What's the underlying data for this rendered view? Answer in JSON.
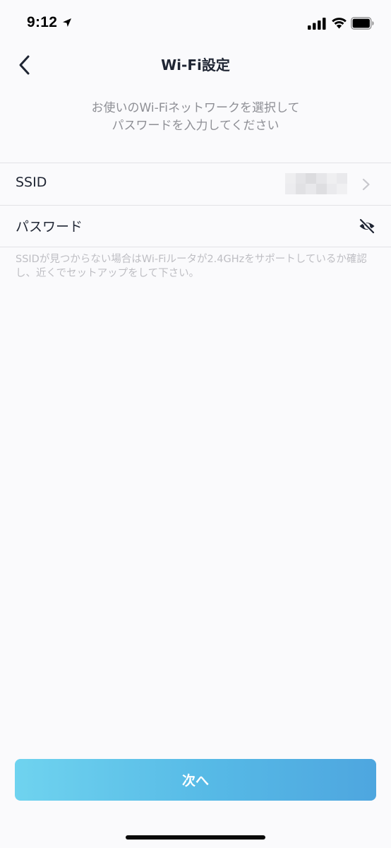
{
  "status_bar": {
    "time": "9:12",
    "icons": [
      "location-arrow-icon",
      "cellular-signal-icon",
      "wifi-icon",
      "battery-icon"
    ]
  },
  "nav": {
    "title": "Wi-Fi設定",
    "back_icon": "chevron-left-icon"
  },
  "instruction": {
    "line1": "お使いのWi-Fiネットワークを選択して",
    "line2": "パスワードを入力してください"
  },
  "form": {
    "ssid": {
      "label": "SSID",
      "value_blurred": true,
      "trailing_icon": "chevron-right-icon"
    },
    "password": {
      "label": "パスワード",
      "value": "",
      "trailing_icon": "eye-slash-icon"
    }
  },
  "hint": "SSIDが見つからない場合はWi-Fiルータが2.4GHzをサポートしているか確認し、近くでセットアップをして下さい。",
  "next_button": {
    "label": "次へ"
  },
  "colors": {
    "background": "#fafafc",
    "title": "#1f2533",
    "secondary_text": "#8e8f95",
    "hint_text": "#bebec3",
    "divider": "#e2e2e6",
    "button_gradient_start": "#6fd3ef",
    "button_gradient_end": "#4ea6df"
  }
}
